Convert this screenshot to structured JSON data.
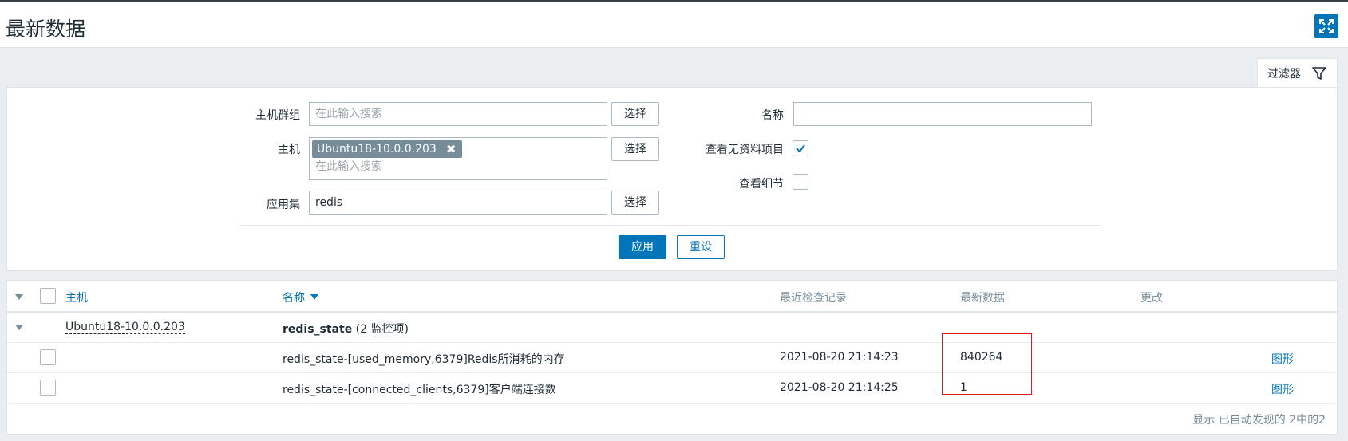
{
  "page": {
    "title": "最新数据"
  },
  "filter": {
    "tab_label": "过滤器",
    "host_groups": {
      "label": "主机群组",
      "placeholder": "在此输入搜索",
      "select_label": "选择"
    },
    "hosts": {
      "label": "主机",
      "selected_chip": "Ubuntu18-10.0.0.203",
      "placeholder": "在此输入搜索",
      "select_label": "选择"
    },
    "application": {
      "label": "应用集",
      "value": "redis",
      "select_label": "选择"
    },
    "name": {
      "label": "名称",
      "value": ""
    },
    "show_without_data": {
      "label": "查看无资料项目",
      "checked": true
    },
    "show_details": {
      "label": "查看细节",
      "checked": false
    },
    "apply_label": "应用",
    "reset_label": "重设"
  },
  "table": {
    "headers": {
      "host": "主机",
      "name": "名称",
      "last_check": "最近检查记录",
      "last_value": "最新数据",
      "change": "更改"
    },
    "group": {
      "host": "Ubuntu18-10.0.0.203",
      "app_name": "redis_state",
      "app_count": "(2 监控项)"
    },
    "rows": [
      {
        "name": "redis_state-[used_memory,6379]Redis所消耗的内存",
        "last_check": "2021-08-20 21:14:23",
        "last_value": "840264",
        "action": "图形"
      },
      {
        "name": "redis_state-[connected_clients,6379]客户端连接数",
        "last_check": "2021-08-20 21:14:25",
        "last_value": "1",
        "action": "图形"
      }
    ],
    "footer": "显示 已自动发现的 2中的2"
  },
  "colors": {
    "accent": "#0275b8",
    "highlight_box": "#e0191f"
  },
  "icons": {
    "fullscreen": "fullscreen-icon",
    "filter": "filter-icon",
    "remove": "close-icon",
    "check": "check-icon",
    "collapse": "triangle-down-icon",
    "sort": "sort-down-icon"
  }
}
